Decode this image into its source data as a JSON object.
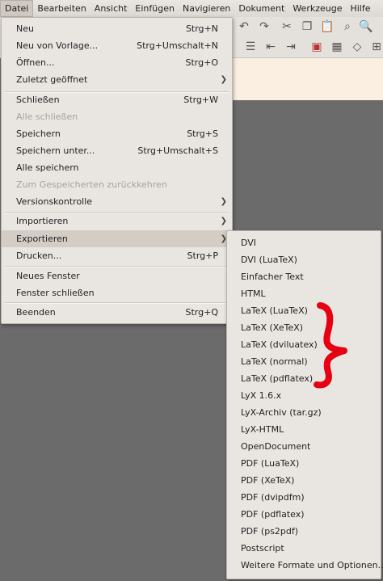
{
  "menubar": [
    "Datei",
    "Bearbeiten",
    "Ansicht",
    "Einfügen",
    "Navigieren",
    "Dokument",
    "Werkzeuge",
    "Hilfe"
  ],
  "datei_menu": [
    {
      "label": "Neu",
      "shortcut": "Strg+N"
    },
    {
      "label": "Neu von Vorlage...",
      "shortcut": "Strg+Umschalt+N"
    },
    {
      "label": "Öffnen...",
      "shortcut": "Strg+O"
    },
    {
      "label": "Zuletzt geöffnet",
      "submenu": true
    },
    {
      "label": "Schließen",
      "shortcut": "Strg+W"
    },
    {
      "label": "Alle schließen",
      "disabled": true
    },
    {
      "label": "Speichern",
      "shortcut": "Strg+S"
    },
    {
      "label": "Speichern unter...",
      "shortcut": "Strg+Umschalt+S"
    },
    {
      "label": "Alle speichern"
    },
    {
      "label": "Zum Gespeicherten zurückkehren",
      "disabled": true
    },
    {
      "label": "Versionskontrolle",
      "submenu": true
    },
    {
      "label": "Importieren",
      "submenu": true
    },
    {
      "label": "Exportieren",
      "submenu": true,
      "highlighted": true
    },
    {
      "label": "Drucken...",
      "shortcut": "Strg+P"
    },
    {
      "label": "Neues Fenster"
    },
    {
      "label": "Fenster schließen"
    },
    {
      "label": "Beenden",
      "shortcut": "Strg+Q"
    }
  ],
  "export_menu": [
    "DVI",
    "DVI (LuaTeX)",
    "Einfacher Text",
    "HTML",
    "LaTeX (LuaTeX)",
    "LaTeX (XeTeX)",
    "LaTeX (dviluatex)",
    "LaTeX (normal)",
    "LaTeX (pdflatex)",
    "LyX 1.6.x",
    "LyX-Archiv (tar.gz)",
    "LyX-HTML",
    "OpenDocument",
    "PDF (LuaTeX)",
    "PDF (XeTeX)",
    "PDF (dvipdfm)",
    "PDF (pdflatex)",
    "PDF (ps2pdf)",
    "Postscript",
    "Weitere Formate und Optionen..."
  ],
  "toolbar_icons": [
    "undo-icon",
    "redo-icon",
    "cut-icon",
    "copy-icon",
    "paste-icon",
    "find-icon",
    "zoom-icon",
    "view-icon"
  ],
  "annotation_color": "#e60012"
}
